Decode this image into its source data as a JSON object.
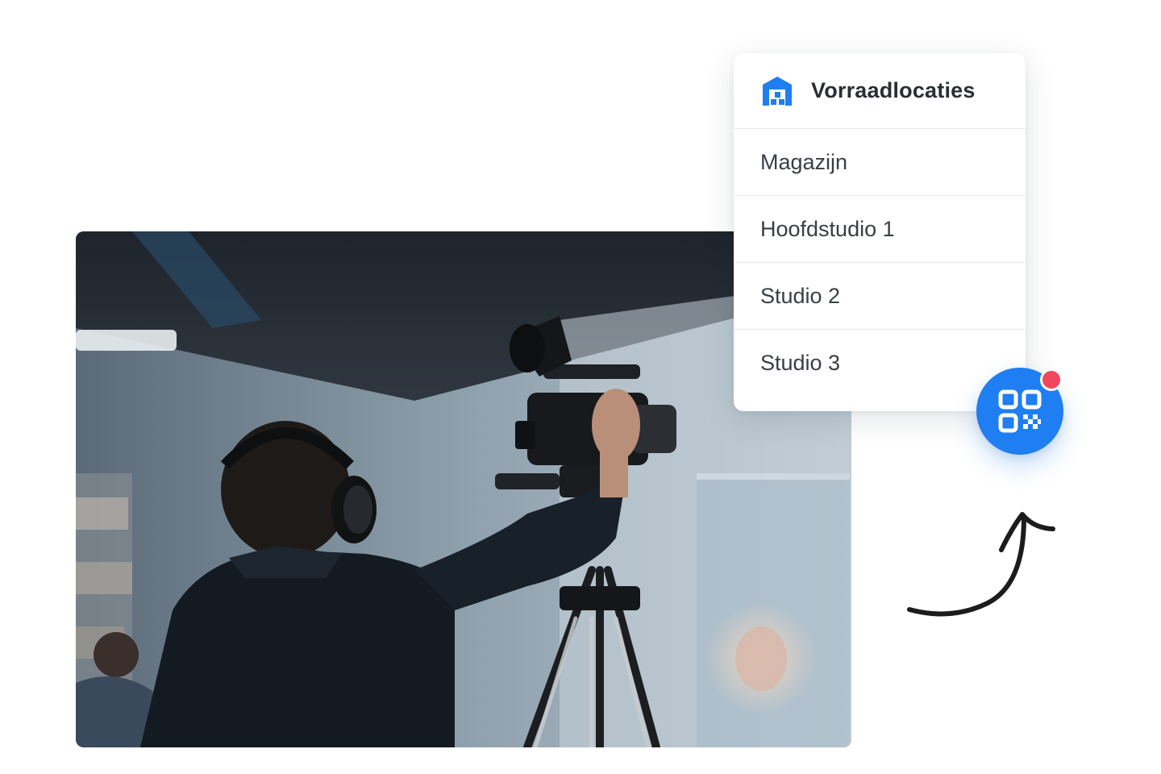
{
  "panel": {
    "title": "Vorraadlocaties",
    "icon": "warehouse-icon",
    "accent_color": "#1f7ef2",
    "locations": [
      {
        "label": "Magazijn"
      },
      {
        "label": "Hoofdstudio 1"
      },
      {
        "label": "Studio 2"
      },
      {
        "label": "Studio 3"
      }
    ]
  },
  "qr_button": {
    "icon": "qr-code-icon",
    "color": "#1f7ef2",
    "badge_color": "#f2455e"
  },
  "photo": {
    "icon": "camera-operator-photo"
  },
  "arrow": {
    "icon": "curved-arrow-icon"
  }
}
